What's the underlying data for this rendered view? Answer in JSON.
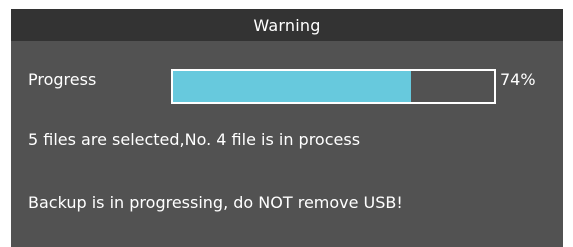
{
  "dialog": {
    "title": "Warning",
    "progress": {
      "label": "Progress",
      "value": 0.74,
      "percent_text": "74%",
      "fill_color": "#67c9dd"
    },
    "status": "5 files are selected,No. 4 file is in process",
    "message": "Backup is in progressing, do NOT remove USB!"
  },
  "colors": {
    "dialog_bg": "#525252",
    "titlebar_bg": "#333333",
    "text": "#ffffff"
  }
}
